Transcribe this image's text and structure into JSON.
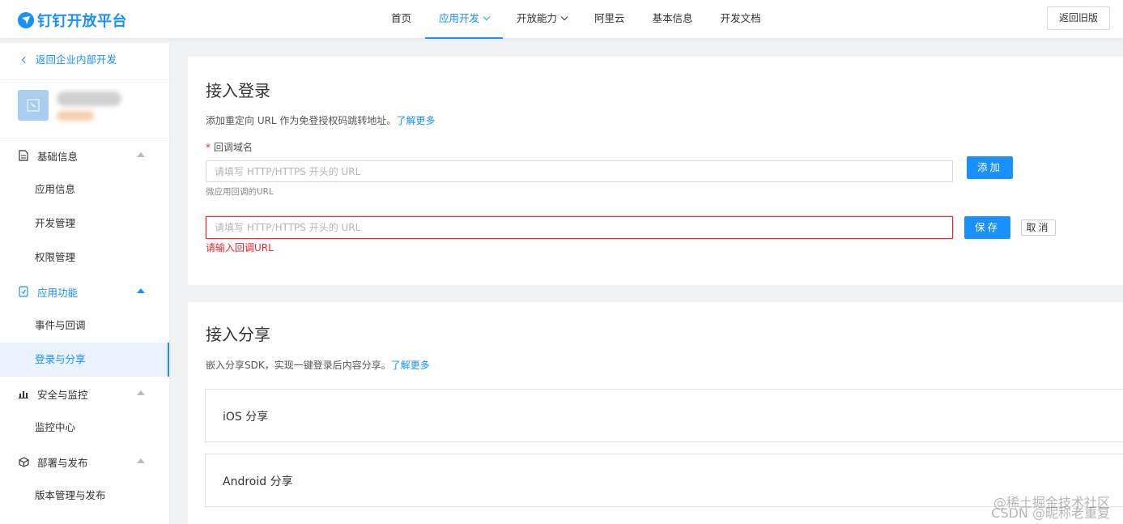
{
  "header": {
    "logo_text": "钉钉开放平台",
    "nav": [
      "首页",
      "应用开发",
      "开放能力",
      "阿里云",
      "基本信息",
      "开发文档"
    ],
    "back_old_label": "返回旧版"
  },
  "sidebar": {
    "back_label": "返回企业内部开发",
    "groups": {
      "basic": {
        "label": "基础信息",
        "items": [
          "应用信息",
          "开发管理",
          "权限管理"
        ]
      },
      "features": {
        "label": "应用功能",
        "items": [
          "事件与回调",
          "登录与分享"
        ]
      },
      "security": {
        "label": "安全与监控",
        "items": [
          "监控中心"
        ]
      },
      "deploy": {
        "label": "部署与发布",
        "items": [
          "版本管理与发布"
        ]
      }
    }
  },
  "login": {
    "title": "接入登录",
    "desc": "添加重定向 URL 作为免登授权码跳转地址。",
    "learn_more": "了解更多",
    "field_label": "回调域名",
    "placeholder": "请填写 HTTP/HTTPS 开头的 URL",
    "hint": "微应用回调的URL",
    "add_label": "添加",
    "save_label": "保存",
    "cancel_label": "取消",
    "error": "请输入回调URL"
  },
  "share": {
    "title": "接入分享",
    "desc": "嵌入分享SDK，实现一键登录后内容分享。",
    "learn_more": "了解更多",
    "ios": "iOS 分享",
    "android": "Android 分享"
  },
  "watermark": {
    "line1": "@稀土掘金技术社区",
    "line2": "CSDN @昵称老重复"
  },
  "colors": {
    "accent": "#1890ff",
    "error": "#f5222d"
  }
}
